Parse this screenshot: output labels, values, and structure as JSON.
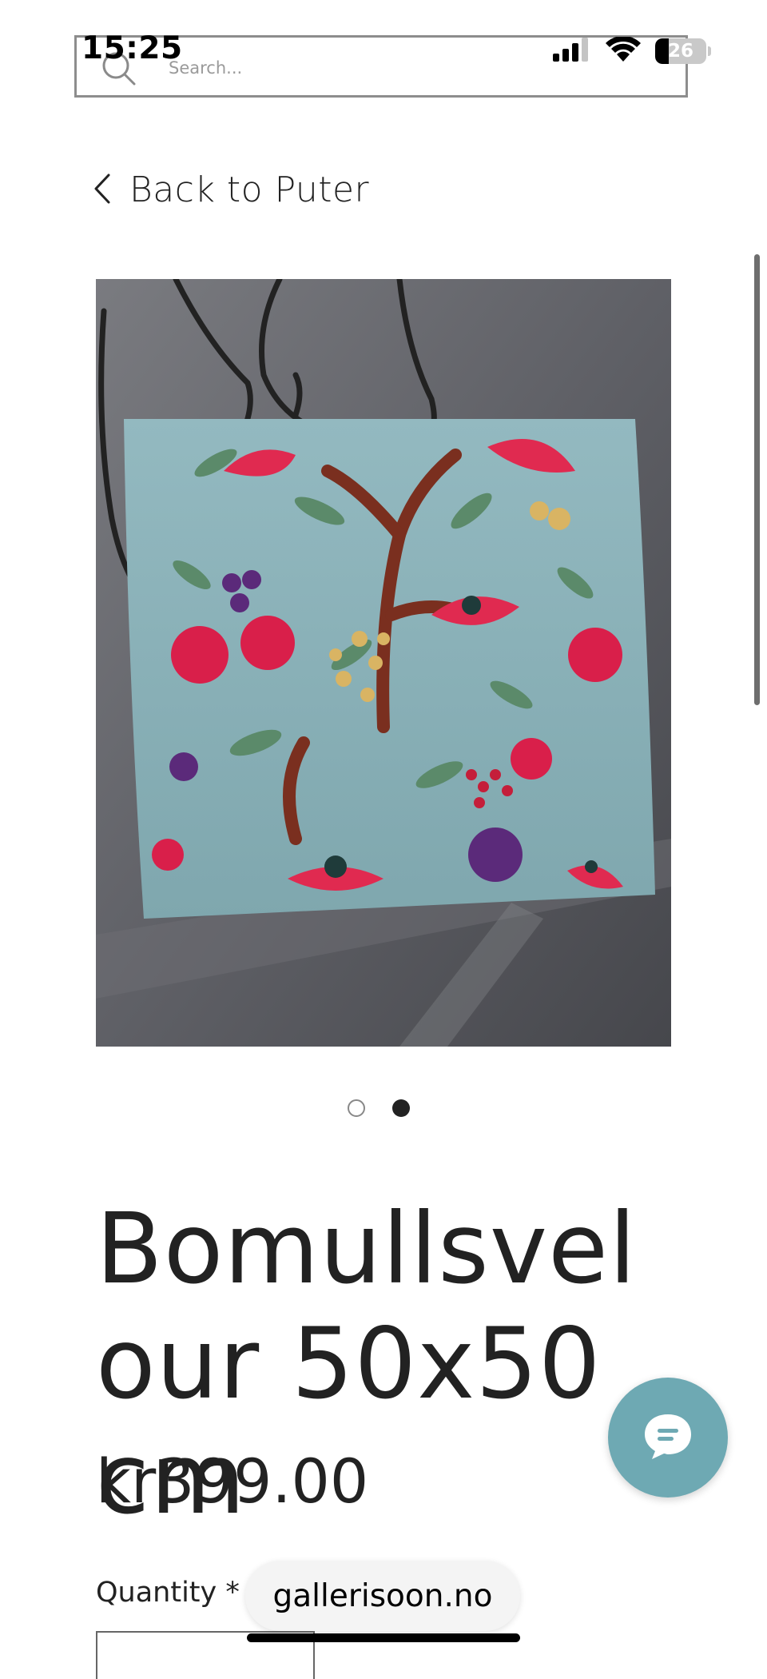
{
  "status_bar": {
    "time": "15:25",
    "battery_level": "26",
    "icons": [
      "cellular-signal-icon",
      "wifi-icon",
      "battery-icon"
    ]
  },
  "search": {
    "placeholder": "Search..."
  },
  "navigation": {
    "back_label": "Back to Puter"
  },
  "product": {
    "image_alt": "Bomullsvelour 50x50cm",
    "title": "Bomullsvelour 50x50cm",
    "price": "kr399.00",
    "quantity_label": "Quantity *",
    "gallery_current": 2,
    "gallery_count": 2
  },
  "browser": {
    "url": "gallerisoon.no"
  },
  "colors": {
    "accent": "#6ea9b3",
    "text": "#222222",
    "border": "#8d8d8d"
  }
}
